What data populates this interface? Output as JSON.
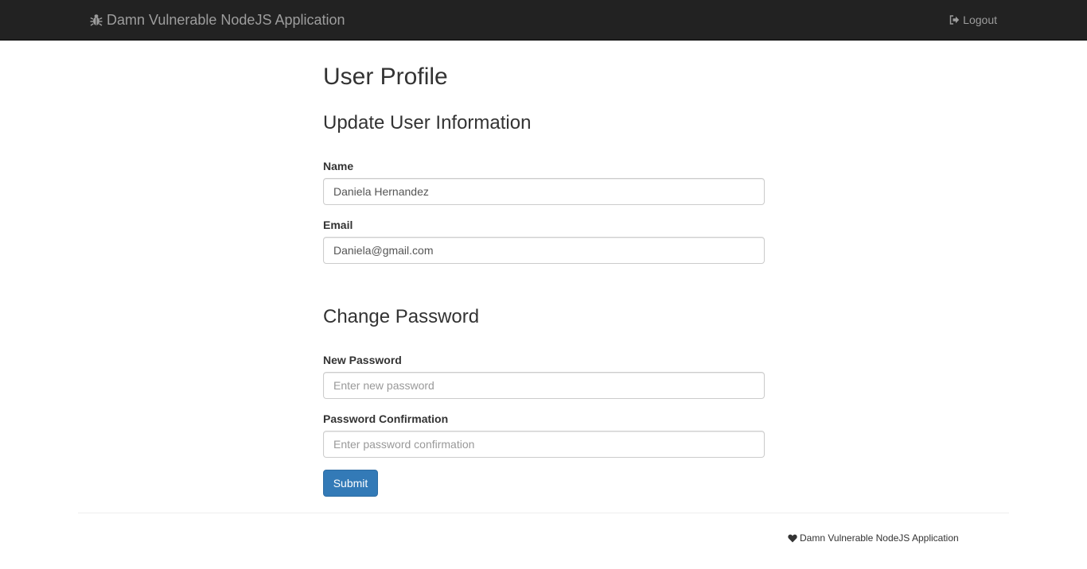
{
  "navbar": {
    "brand": "Damn Vulnerable NodeJS Application",
    "brand_icon": "bug-icon",
    "logout_label": "Logout",
    "logout_icon": "logout-icon",
    "background": "#222222"
  },
  "page": {
    "title": "User Profile"
  },
  "update_info": {
    "title": "Update User Information",
    "name_label": "Name",
    "name_value": "Daniela Hernandez",
    "email_label": "Email",
    "email_value": "Daniela@gmail.com"
  },
  "change_password": {
    "title": "Change Password",
    "new_password_label": "New Password",
    "new_password_placeholder": "Enter new password",
    "confirmation_label": "Password Confirmation",
    "confirmation_placeholder": "Enter password confirmation"
  },
  "submit_label": "Submit",
  "footer": {
    "text": "Damn Vulnerable NodeJS Application",
    "icon": "heart-icon"
  },
  "colors": {
    "primary_button": "#337ab7"
  }
}
